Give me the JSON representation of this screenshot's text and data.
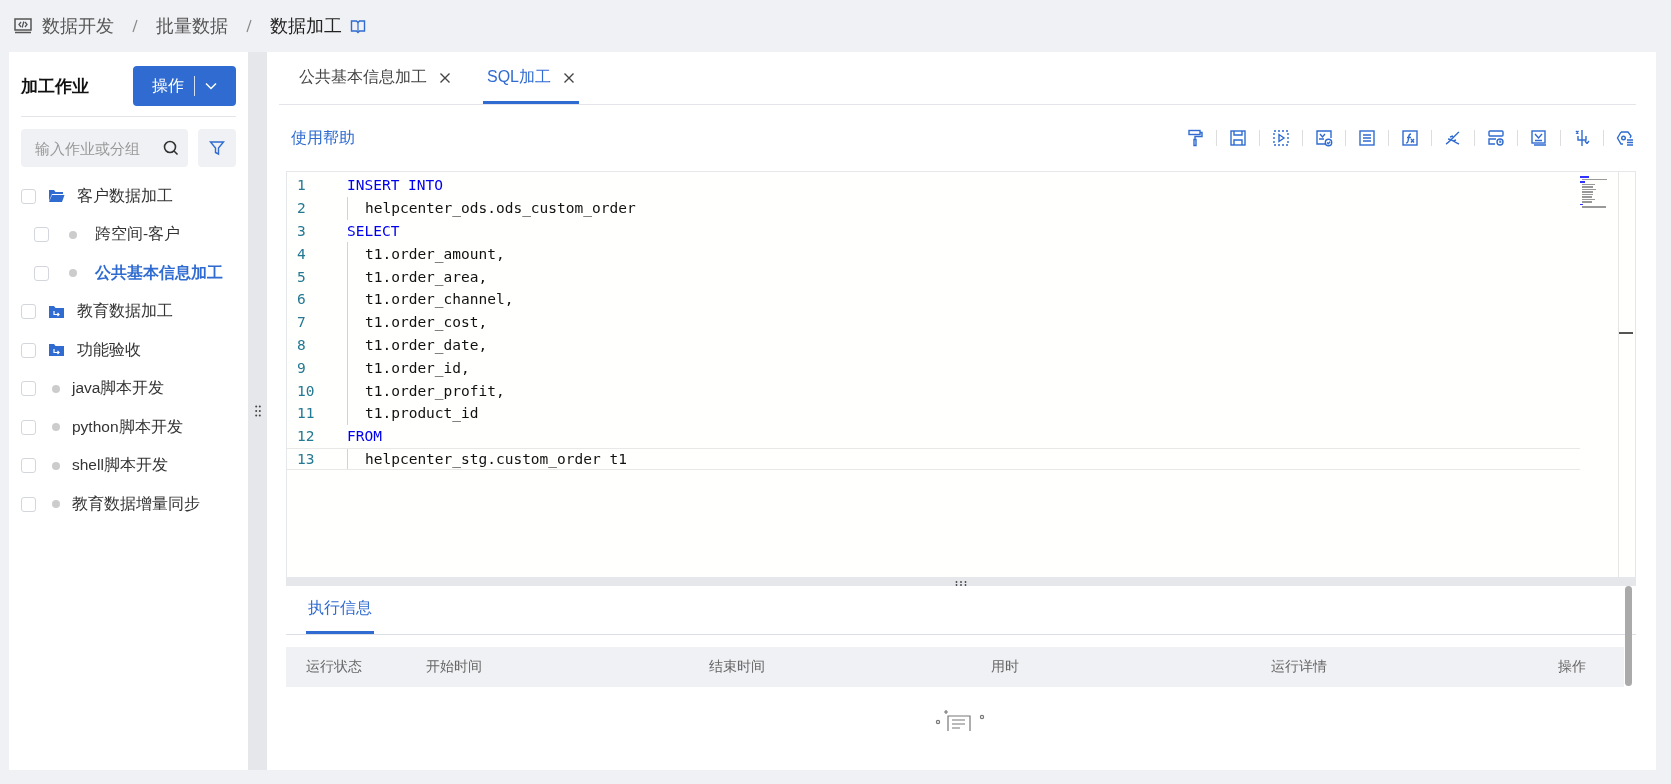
{
  "breadcrumb": [
    "数据开发",
    "批量数据",
    "数据加工"
  ],
  "sidebar": {
    "title": "加工作业",
    "action_button": "操作",
    "search": {
      "placeholder": "输入作业或分组"
    },
    "items": [
      {
        "kind": "folder",
        "label": "客户数据加工",
        "checked": false,
        "selected": false,
        "expanded": true,
        "children": [
          {
            "kind": "job",
            "label": "跨空间-客户",
            "checked": false,
            "selected": false
          },
          {
            "kind": "job",
            "label": "公共基本信息加工",
            "checked": false,
            "selected": true
          }
        ]
      },
      {
        "kind": "folder",
        "label": "教育数据加工",
        "checked": false,
        "selected": false,
        "expanded": false
      },
      {
        "kind": "folder",
        "label": "功能验收",
        "checked": false,
        "selected": false,
        "expanded": false
      },
      {
        "kind": "job",
        "label": "java脚本开发",
        "checked": false,
        "selected": false
      },
      {
        "kind": "job",
        "label": "python脚本开发",
        "checked": false,
        "selected": false
      },
      {
        "kind": "job",
        "label": "shell脚本开发",
        "checked": false,
        "selected": false
      },
      {
        "kind": "job",
        "label": "教育数据增量同步",
        "checked": false,
        "selected": false
      }
    ]
  },
  "tabs": [
    {
      "label": "公共基本信息加工",
      "selected": false
    },
    {
      "label": "SQL加工",
      "selected": true
    }
  ],
  "help_link": "使用帮助",
  "editor": {
    "lines": [
      {
        "number": "1",
        "kind": "keyword",
        "text": "INSERT INTO",
        "selected": false
      },
      {
        "number": "2",
        "kind": "code",
        "text": "helpcenter_ods.ods_custom_order",
        "selected": false
      },
      {
        "number": "3",
        "kind": "keyword",
        "text": "SELECT",
        "selected": false
      },
      {
        "number": "4",
        "kind": "code",
        "text": "t1.order_amount,",
        "selected": false
      },
      {
        "number": "5",
        "kind": "code",
        "text": "t1.order_area,",
        "selected": false
      },
      {
        "number": "6",
        "kind": "code",
        "text": "t1.order_channel,",
        "selected": false
      },
      {
        "number": "7",
        "kind": "code",
        "text": "t1.order_cost,",
        "selected": false
      },
      {
        "number": "8",
        "kind": "code",
        "text": "t1.order_date,",
        "selected": false
      },
      {
        "number": "9",
        "kind": "code",
        "text": "t1.order_id,",
        "selected": false
      },
      {
        "number": "10",
        "kind": "code",
        "text": "t1.order_profit,",
        "selected": false
      },
      {
        "number": "11",
        "kind": "code",
        "text": "t1.product_id",
        "selected": false
      },
      {
        "number": "12",
        "kind": "keyword",
        "text": "FROM",
        "selected": false
      },
      {
        "number": "13",
        "kind": "code",
        "text": "helpcenter_stg.custom_order t1",
        "selected": true
      }
    ]
  },
  "result_tabs": [
    {
      "label": "执行信息",
      "selected": true
    }
  ],
  "table": {
    "columns": [
      "运行状态",
      "开始时间",
      "结束时间",
      "用时",
      "运行详情",
      "操作"
    ]
  }
}
